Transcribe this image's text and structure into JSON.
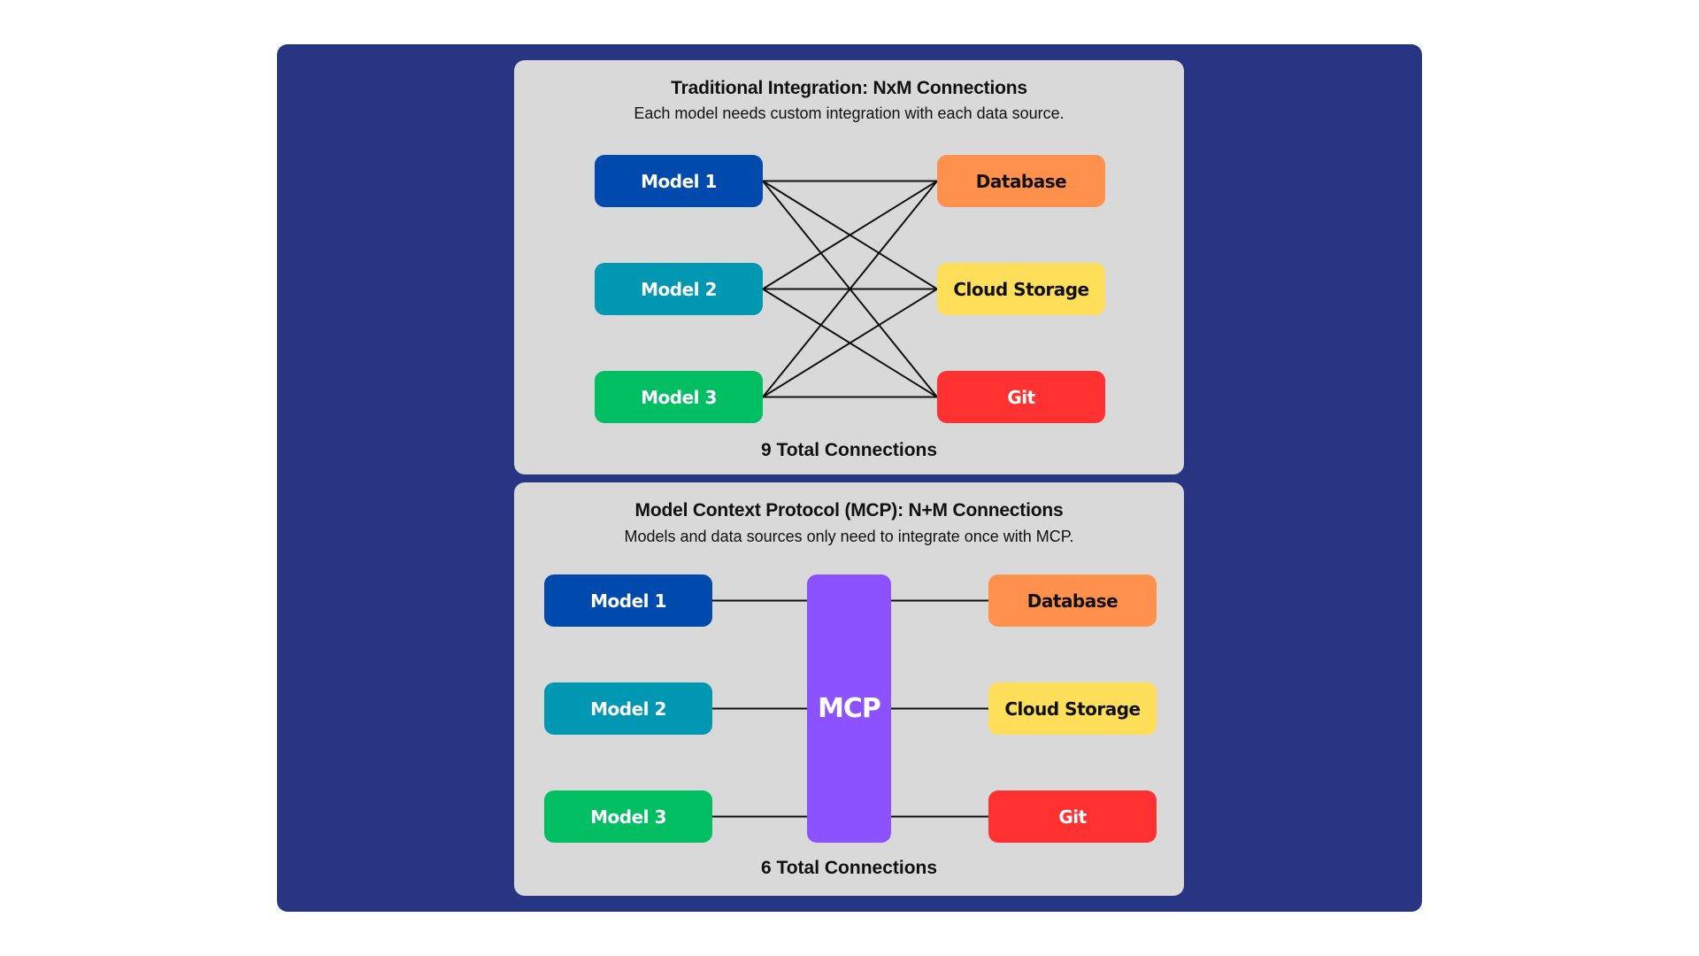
{
  "colors": {
    "background": "#ffffff",
    "outer_frame": "#283582",
    "panel": "#d9d9d9",
    "line": "#111111",
    "model_1": "#004aad",
    "model_2": "#0097b2",
    "model_3": "#00bf63",
    "database": "#ff914d",
    "cloud_storage": "#ffde59",
    "git": "#ff3131",
    "mcp": "#8c52ff"
  },
  "traditional": {
    "title": "Traditional Integration: NxM Connections",
    "subtitle": "Each model needs custom integration with each data source.",
    "total": "9 Total Connections",
    "models": [
      {
        "label": "Model 1",
        "color_key": "model_1"
      },
      {
        "label": "Model 2",
        "color_key": "model_2"
      },
      {
        "label": "Model 3",
        "color_key": "model_3"
      }
    ],
    "sources": [
      {
        "label": "Database",
        "color_key": "database"
      },
      {
        "label": "Cloud Storage",
        "color_key": "cloud_storage"
      },
      {
        "label": "Git",
        "color_key": "git"
      }
    ],
    "connections": [
      [
        0,
        0
      ],
      [
        0,
        1
      ],
      [
        0,
        2
      ],
      [
        1,
        0
      ],
      [
        1,
        1
      ],
      [
        1,
        2
      ],
      [
        2,
        0
      ],
      [
        2,
        1
      ],
      [
        2,
        2
      ]
    ]
  },
  "mcp": {
    "title": "Model Context Protocol (MCP): N+M Connections",
    "subtitle": "Models and data sources only need to integrate once with MCP.",
    "total": "6 Total Connections",
    "hub_label": "MCP",
    "models": [
      {
        "label": "Model 1",
        "color_key": "model_1"
      },
      {
        "label": "Model 2",
        "color_key": "model_2"
      },
      {
        "label": "Model 3",
        "color_key": "model_3"
      }
    ],
    "sources": [
      {
        "label": "Database",
        "color_key": "database"
      },
      {
        "label": "Cloud Storage",
        "color_key": "cloud_storage"
      },
      {
        "label": "Git",
        "color_key": "git"
      }
    ]
  }
}
